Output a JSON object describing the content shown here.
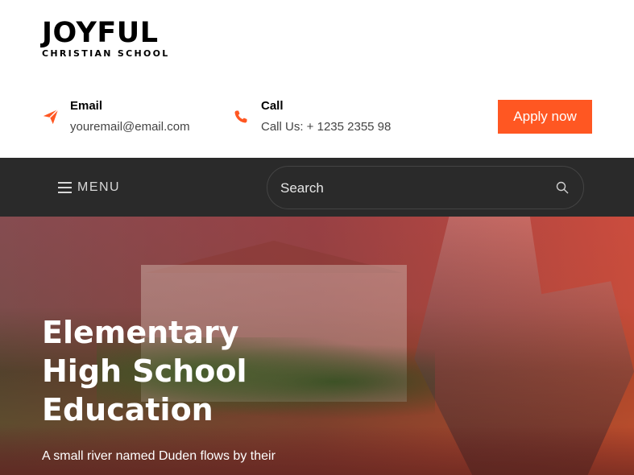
{
  "logo": {
    "main": "JOYFUL",
    "sub": "CHRISTIAN SCHOOL"
  },
  "contacts": {
    "email": {
      "title": "Email",
      "value": "youremail@email.com",
      "icon": "paper-plane-icon"
    },
    "call": {
      "title": "Call",
      "value": "Call Us: + 1235 2355 98",
      "icon": "phone-icon"
    }
  },
  "apply_label": "Apply now",
  "nav": {
    "menu_label": "MENU",
    "menu_icon": "hamburger-icon"
  },
  "search": {
    "placeholder": "Search",
    "icon": "search-icon"
  },
  "hero": {
    "title_lines": [
      "Elementary",
      "High School",
      "Education"
    ],
    "text": "A small river named Duden flows by their"
  },
  "colors": {
    "accent": "#ff5722",
    "nav_bg": "#2a2a2a",
    "text": "#000000"
  }
}
